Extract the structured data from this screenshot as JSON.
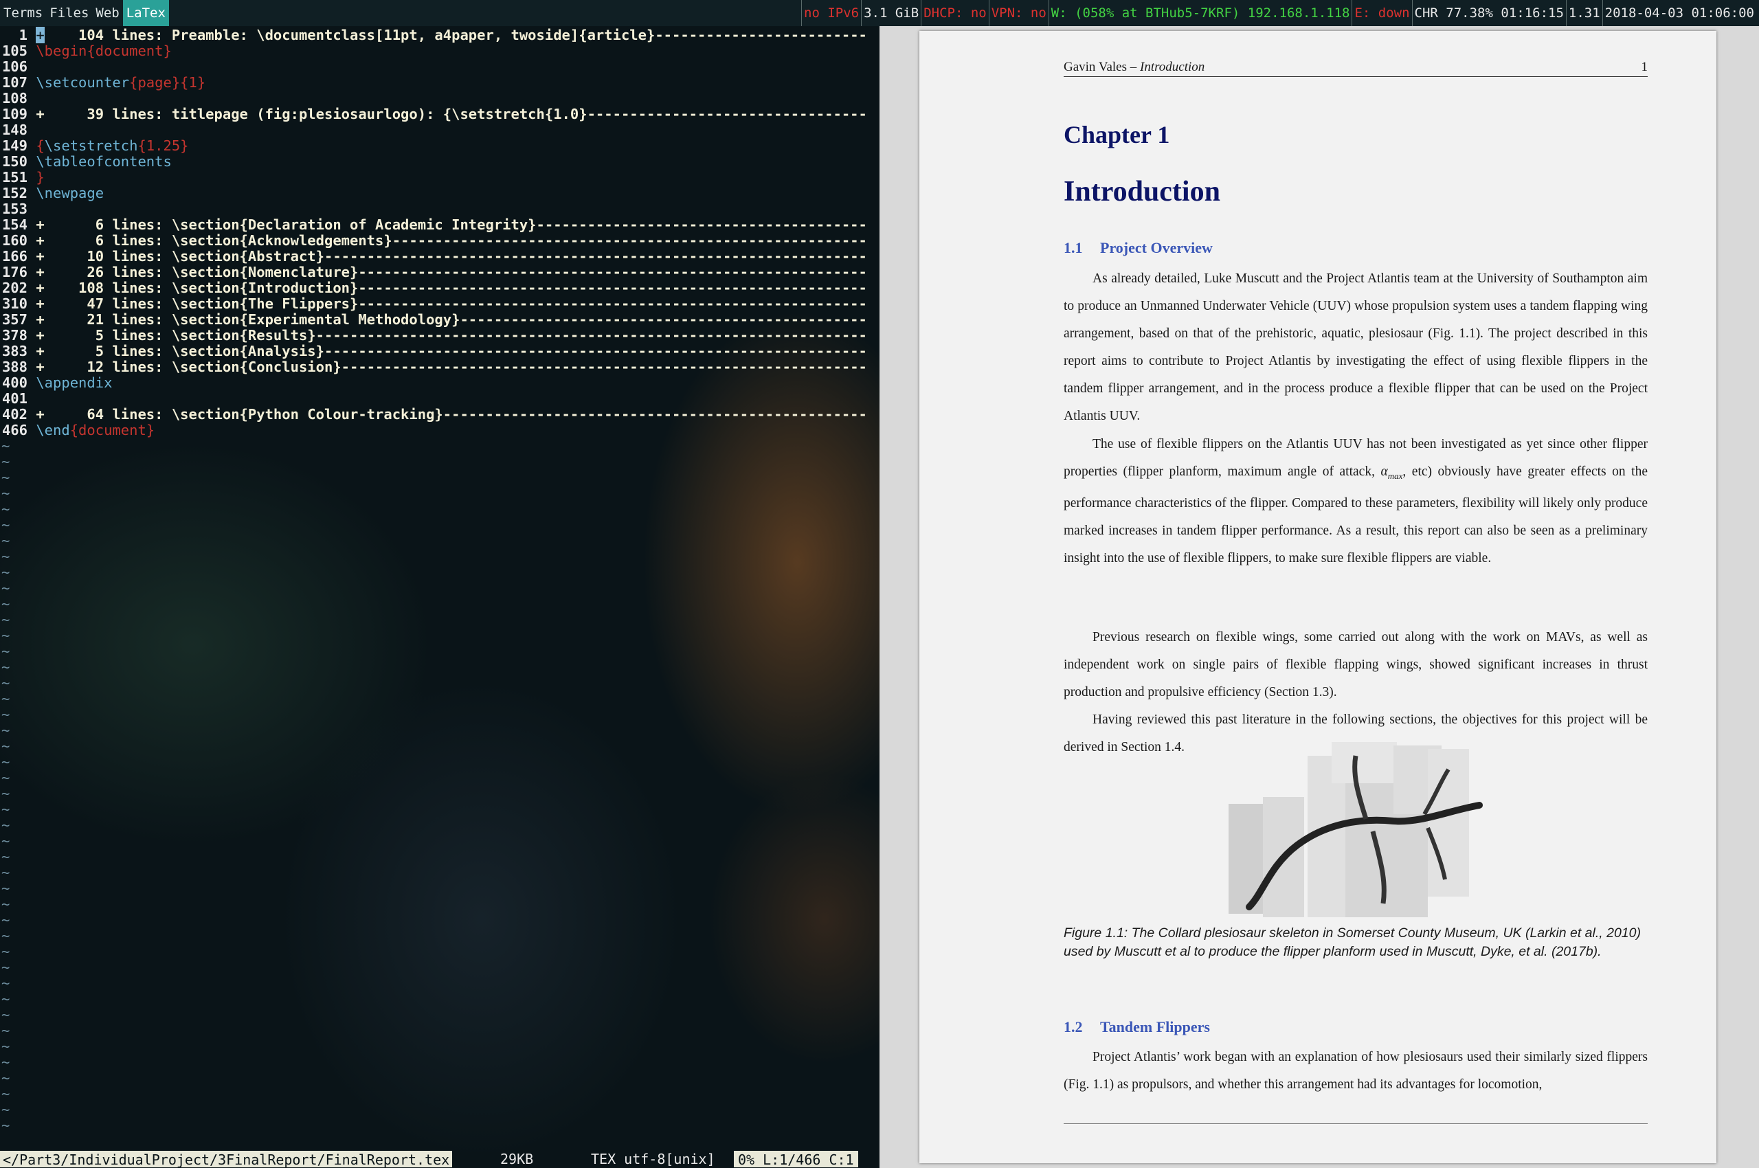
{
  "workspaces": [
    "Terms",
    "Files",
    "Web",
    "LaTex"
  ],
  "active_workspace": "LaTex",
  "statusbar": [
    {
      "text": "no IPv6",
      "color": "#dc322f"
    },
    {
      "text": "3.1 GiB",
      "color": "#e8e8e8"
    },
    {
      "text": "DHCP: no",
      "color": "#dc322f"
    },
    {
      "text": "VPN: no",
      "color": "#dc322f"
    },
    {
      "text": "W: (058% at BTHub5-7KRF) 192.168.1.118",
      "color": "#43d343"
    },
    {
      "text": "E: down",
      "color": "#dc322f"
    },
    {
      "text": "CHR 77.38% 01:16:15",
      "color": "#e8e8e8"
    },
    {
      "text": "1.31",
      "color": "#e8e8e8"
    },
    {
      "text": "2018-04-03 01:06:00",
      "color": "#e8e8e8"
    }
  ],
  "editor": {
    "lines": [
      {
        "n": "1",
        "kind": "fold",
        "cursor": "+",
        "text": "    104 lines: Preamble: \\documentclass[11pt, a4paper, twoside]{article}"
      },
      {
        "n": "105",
        "kind": "red",
        "text": "\\begin{document}"
      },
      {
        "n": "106",
        "kind": "empty",
        "text": ""
      },
      {
        "n": "107",
        "kind": "cmdargs",
        "cmd": "\\setcounter",
        "args": "{page}{1}"
      },
      {
        "n": "108",
        "kind": "empty",
        "text": ""
      },
      {
        "n": "109",
        "kind": "fold",
        "text": "+     39 lines: titlepage (fig:plesiosaurlogo): {\\setstretch{1.0}"
      },
      {
        "n": "148",
        "kind": "empty",
        "text": ""
      },
      {
        "n": "149",
        "kind": "cmdargs",
        "pre": "{",
        "cmd": "\\setstretch",
        "args": "{1.25}"
      },
      {
        "n": "150",
        "kind": "cmd",
        "text": "\\tableofcontents"
      },
      {
        "n": "151",
        "kind": "red",
        "text": "}"
      },
      {
        "n": "152",
        "kind": "cmd",
        "text": "\\newpage"
      },
      {
        "n": "153",
        "kind": "empty",
        "text": ""
      },
      {
        "n": "154",
        "kind": "fold",
        "text": "+      6 lines: \\section{Declaration of Academic Integrity}"
      },
      {
        "n": "160",
        "kind": "fold",
        "text": "+      6 lines: \\section{Acknowledgements}"
      },
      {
        "n": "166",
        "kind": "fold",
        "text": "+     10 lines: \\section{Abstract}"
      },
      {
        "n": "176",
        "kind": "fold",
        "text": "+     26 lines: \\section{Nomenclature}"
      },
      {
        "n": "202",
        "kind": "fold",
        "text": "+    108 lines: \\section{Introduction}"
      },
      {
        "n": "310",
        "kind": "fold",
        "text": "+     47 lines: \\section{The Flippers}"
      },
      {
        "n": "357",
        "kind": "fold",
        "text": "+     21 lines: \\section{Experimental Methodology}"
      },
      {
        "n": "378",
        "kind": "fold",
        "text": "+      5 lines: \\section{Results}"
      },
      {
        "n": "383",
        "kind": "fold",
        "text": "+      5 lines: \\section{Analysis}"
      },
      {
        "n": "388",
        "kind": "fold",
        "text": "+     12 lines: \\section{Conclusion}"
      },
      {
        "n": "400",
        "kind": "cmd",
        "text": "\\appendix"
      },
      {
        "n": "401",
        "kind": "empty",
        "text": ""
      },
      {
        "n": "402",
        "kind": "fold",
        "text": "+     64 lines: \\section{Python Colour-tracking}"
      },
      {
        "n": "466",
        "kind": "end",
        "cmd": "\\end",
        "args": "{document}"
      }
    ],
    "tilde": "~",
    "status": {
      "path": "</Part3/IndividualProject/3FinalReport/FinalReport.tex",
      "size": "29KB",
      "filetype": "TEX utf-8[unix]",
      "position": "0% L:1/466 C:1"
    }
  },
  "pdf": {
    "header_author": "Gavin Vales – ",
    "header_section": "Introduction",
    "page_number": "1",
    "chapter_label": "Chapter  1",
    "chapter_title": "Introduction",
    "section1_number": "1.1",
    "section1_title": "Project Overview",
    "para1": "As already detailed, Luke Muscutt and the Project Atlantis team at the University of Southampton aim to produce an Unmanned Underwater Vehicle (UUV) whose propulsion system uses a tandem flapping wing arrangement, based on that of the prehistoric, aquatic, plesiosaur (Fig. 1.1). The project described in this report aims to contribute to Project Atlantis by investigating the effect of using flexible flippers in the tandem flipper arrangement, and in the process produce a flexible flipper that can be used on the Project Atlantis UUV.",
    "para2_before": "The use of flexible flippers on the Atlantis UUV has not been investigated as yet since other flipper properties (flipper planform, maximum angle of attack, ",
    "para2_symbol": "α",
    "para2_subscript": "max",
    "para2_after": ", etc) obviously have greater effects on the performance characteristics of the flipper.  Compared to these parameters, flexibility will likely only produce marked increases in tandem flipper performance. As a result, this report can also be seen as a preliminary insight into the use of flexible flippers, to make sure flexible flippers are viable.",
    "para3": "Previous research on flexible wings, some carried out along with the work on MAVs, as well as independent work on single pairs of flexible flapping wings, showed significant increases in thrust production and propulsive efficiency (Section 1.3).",
    "para4": "Having reviewed this past literature in the following sections, the objectives for this project will be derived in Section 1.4.",
    "figure_caption": "Figure 1.1: The Collard plesiosaur skeleton in Somerset County Museum, UK (Larkin et al., 2010) used by Muscutt et al to produce the flipper planform used in Muscutt, Dyke, et al. (2017b).",
    "section2_number": "1.2",
    "section2_title": "Tandem Flippers",
    "para5": "Project Atlantis’ work began with an explanation of how plesiosaurs used their similarly sized flippers (Fig. 1.1) as propulsors, and whether this arrangement had its advantages for locomotion,"
  }
}
